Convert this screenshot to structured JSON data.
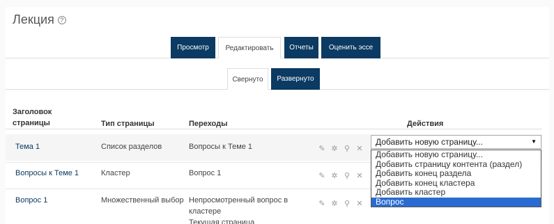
{
  "page": {
    "title": "Лекция",
    "help_glyph": "?"
  },
  "tabs": [
    {
      "label": "Просмотр",
      "active": false
    },
    {
      "label": "Редактировать",
      "active": true
    },
    {
      "label": "Отчеты",
      "active": false
    },
    {
      "label": "Оценить эссе",
      "active": false
    }
  ],
  "subtabs": [
    {
      "label": "Свернуто",
      "active": true
    },
    {
      "label": "Развернуто",
      "active": false
    }
  ],
  "table": {
    "headers": {
      "title_line1": "Заголовок",
      "title_line2": "страницы",
      "type": "Тип страницы",
      "transitions": "Переходы",
      "actions": "Действия"
    },
    "rows": [
      {
        "title": "Тема 1",
        "type": "Список разделов",
        "transitions_1": "Вопросы к Теме 1",
        "transitions_2": "",
        "transitions_3": ""
      },
      {
        "title": "Вопросы к Теме 1",
        "type": "Кластер",
        "transitions_1": "Вопрос 1",
        "transitions_2": "",
        "transitions_3": ""
      },
      {
        "title": "Вопрос 1",
        "type": "Множественный выбор",
        "transitions_1": "Непросмотренный вопрос в",
        "transitions_2": "кластере",
        "transitions_3": "Текущая страница"
      }
    ]
  },
  "action_icons": [
    "move-icon",
    "gear-icon",
    "search-icon",
    "delete-icon"
  ],
  "select": {
    "value": "Добавить новую страницу...",
    "options": [
      "Добавить новую страницу...",
      "Добавить страницу контента (раздел)",
      "Добавить конец раздела",
      "Добавить конец кластера",
      "Добавить кластер",
      "Вопрос"
    ],
    "highlighted": "Вопрос"
  },
  "colors": {
    "tab_dark": "#0b3a62",
    "highlight": "#2a6bd1",
    "link": "#0b3a62"
  }
}
